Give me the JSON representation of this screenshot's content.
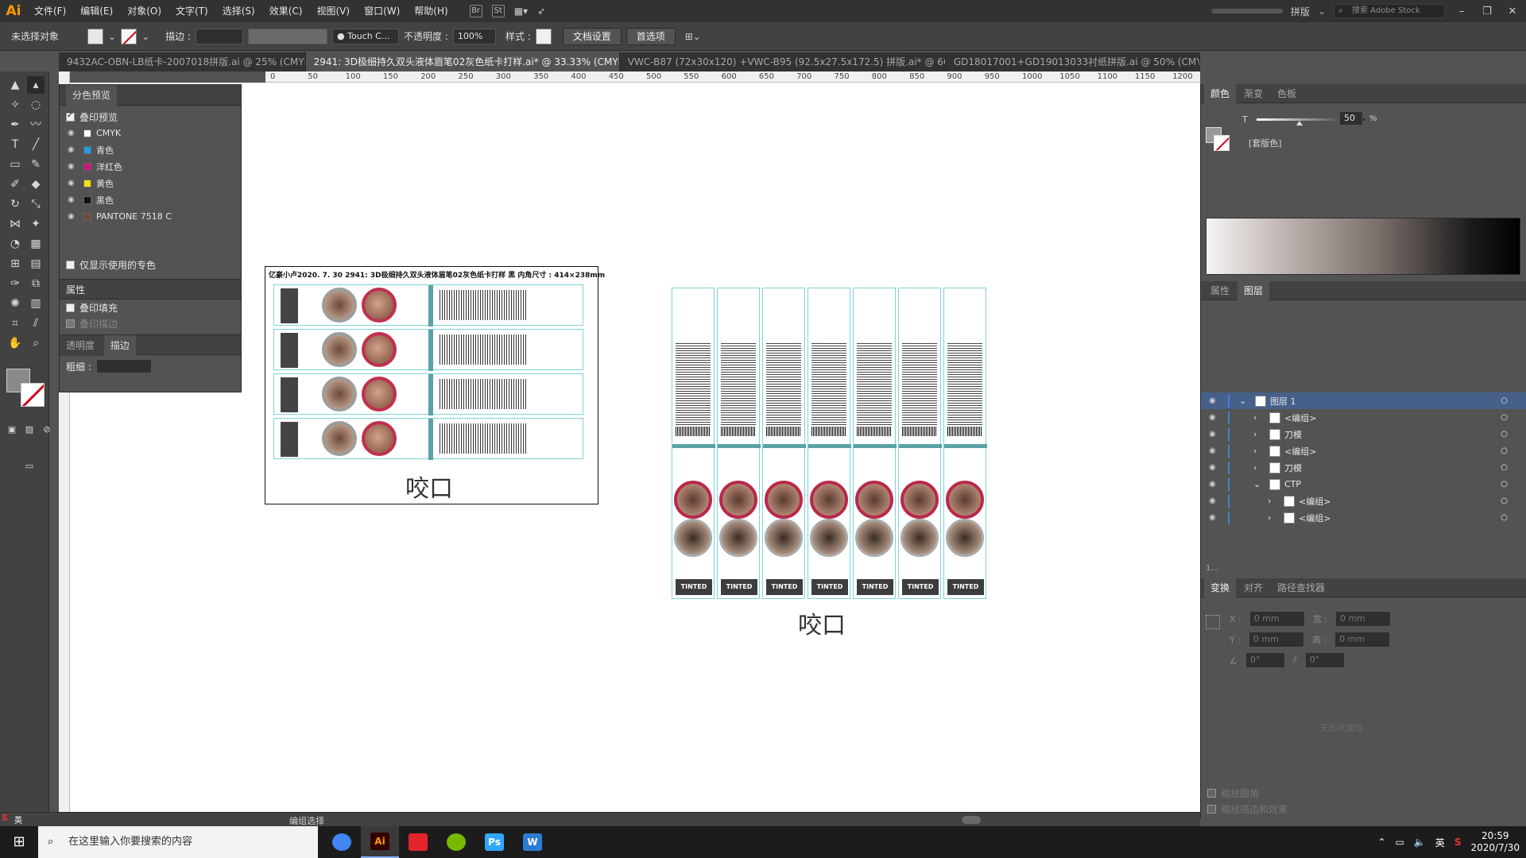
{
  "app": {
    "logo": "Ai"
  },
  "menu": [
    "文件(F)",
    "编辑(E)",
    "对象(O)",
    "文字(T)",
    "选择(S)",
    "效果(C)",
    "视图(V)",
    "窗口(W)",
    "帮助(H)"
  ],
  "menu_icons": [
    "Br",
    "St"
  ],
  "workspace": "拼版",
  "stock_search_placeholder": "搜索 Adobe Stock",
  "control_bar": {
    "selection": "未选择对象",
    "stroke_label": "描边 :",
    "brush": "Touch C...",
    "opacity_label": "不透明度 :",
    "opacity_value": "100%",
    "style_label": "样式 :",
    "doc_setup": "文档设置",
    "preferences": "首选项"
  },
  "tabs": [
    {
      "label": "9432AC-OBN-LB纸卡-2007018拼版.ai @ 25% (CMYK/叠印预...",
      "active": false
    },
    {
      "label": "2941: 3D极细持久双头液体眉笔02灰色纸卡打样.ai* @ 33.33% (CMYK/叠印预览)",
      "active": true
    },
    {
      "label": "VWC-B87 (72x30x120) +VWC-B95 (92.5x27.5x172.5) 拼版.ai* @ 66.67% (CMY...",
      "active": false
    },
    {
      "label": "GD18017001+GD19013033衬纸拼版.ai @ 50% (CMYK/叠印预...",
      "active": false
    }
  ],
  "ruler_ticks": [
    "0",
    "50",
    "100",
    "150",
    "200",
    "250",
    "300",
    "350",
    "400",
    "450",
    "500",
    "550",
    "600",
    "650",
    "700",
    "750",
    "800",
    "850",
    "900",
    "950",
    "1000",
    "1050",
    "1100",
    "1150",
    "1200"
  ],
  "separations": {
    "title": "分色预览",
    "overprint_preview": "叠印预览",
    "items": [
      {
        "name": "CMYK",
        "color": "#ffffff"
      },
      {
        "name": "青色",
        "color": "#1e9be8"
      },
      {
        "name": "洋红色",
        "color": "#d2127a"
      },
      {
        "name": "黄色",
        "color": "#f5e20a"
      },
      {
        "name": "黑色",
        "color": "#111111"
      },
      {
        "name": "PANTONE 7518 C",
        "color": "#6c4a3d"
      }
    ],
    "show_used_spots": "仅显示使用的专色"
  },
  "attributes": {
    "title": "属性",
    "overprint_fill": "叠印填充",
    "overprint_stroke": "叠印描边"
  },
  "stroke_panel": {
    "tab_transparency": "透明度",
    "tab_stroke": "描边",
    "weight_label": "粗细 :"
  },
  "artboard_left": {
    "title": "亿豪小卢2020. 7. 30  2941: 3D极细持久双头液体眉笔02灰色纸卡打样  黑  内角尺寸 : 414×238mm",
    "caption": "咬口"
  },
  "artboard_right": {
    "caption": "咬口",
    "strip_label": "TINTED"
  },
  "color_panel": {
    "tabs": [
      "颜色",
      "渐变",
      "色板"
    ],
    "tint_label": "T",
    "tint_value": "50",
    "tint_unit": "%",
    "swatch_name": "[套版色]"
  },
  "layers_panel": {
    "tabs": [
      "属性",
      "图层"
    ],
    "rows": [
      {
        "name": "图层 1",
        "indent": 0,
        "open": true,
        "selected": true
      },
      {
        "name": "<编组>",
        "indent": 1,
        "open": false
      },
      {
        "name": "刀模",
        "indent": 1,
        "open": false
      },
      {
        "name": "<编组>",
        "indent": 1,
        "open": false
      },
      {
        "name": "刀模",
        "indent": 1,
        "open": false
      },
      {
        "name": "CTP",
        "indent": 1,
        "open": true
      },
      {
        "name": "<编组>",
        "indent": 2,
        "open": false
      },
      {
        "name": "<编组>",
        "indent": 2,
        "open": false
      }
    ],
    "count": "1..."
  },
  "transform_panel": {
    "tabs": [
      "变换",
      "对齐",
      "路径查找器"
    ],
    "x_label": "X :",
    "x_value": "0 mm",
    "y_label": "Y :",
    "y_value": "0 mm",
    "w_label": "宽 :",
    "w_value": "0 mm",
    "h_label": "高 :",
    "h_value": "0 mm",
    "angle_value": "0°",
    "shear_value": "0°",
    "no_shape": "无形状属性",
    "scale_corners": "缩放圆角",
    "scale_strokes": "缩放描边和效果"
  },
  "status": {
    "text": "编组选择"
  },
  "taskbar": {
    "search_placeholder": "在这里输入你要搜索的内容",
    "apps": [
      {
        "name": "chrome",
        "label": "",
        "color": "#4285f4"
      },
      {
        "name": "illustrator",
        "label": "Ai",
        "color": "#ff9a00"
      },
      {
        "name": "acrobat",
        "label": "",
        "color": "#e3242b"
      },
      {
        "name": "app-green",
        "label": "",
        "color": "#76b900"
      },
      {
        "name": "photoshop",
        "label": "Ps",
        "color": "#31a8ff"
      },
      {
        "name": "word",
        "label": "W",
        "color": "#2b7cd3"
      }
    ],
    "ime": "英",
    "time": "20:59",
    "date": "2020/7/30"
  }
}
